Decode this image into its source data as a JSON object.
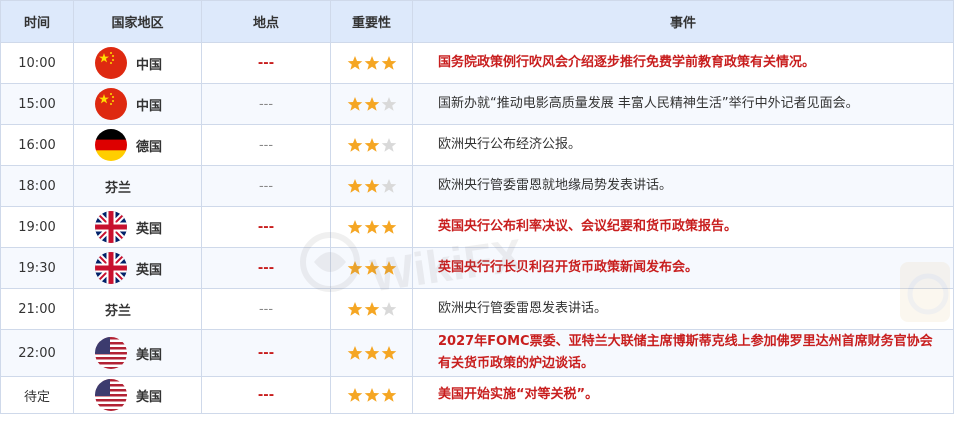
{
  "headers": {
    "time": "时间",
    "country": "国家地区",
    "location": "地点",
    "importance": "重要性",
    "event": "事件"
  },
  "rows": [
    {
      "time": "10:00",
      "flag": "china-flag-icon",
      "country": "中国",
      "location": "---",
      "stars": 3,
      "event": "国务院政策例行吹风会介绍逐步推行免费学前教育政策有关情况。",
      "highlight": true
    },
    {
      "time": "15:00",
      "flag": "china-flag-icon",
      "country": "中国",
      "location": "---",
      "stars": 2,
      "event": "国新办就“推动电影高质量发展 丰富人民精神生活”举行中外记者见面会。",
      "highlight": false
    },
    {
      "time": "16:00",
      "flag": "germany-flag-icon",
      "country": "德国",
      "location": "---",
      "stars": 2,
      "event": "欧洲央行公布经济公报。",
      "highlight": false
    },
    {
      "time": "18:00",
      "flag": "",
      "country": "芬兰",
      "location": "---",
      "stars": 2,
      "event": "欧洲央行管委雷恩就地缘局势发表讲话。",
      "highlight": false
    },
    {
      "time": "19:00",
      "flag": "uk-flag-icon",
      "country": "英国",
      "location": "---",
      "stars": 3,
      "event": "英国央行公布利率决议、会议纪要和货币政策报告。",
      "highlight": true
    },
    {
      "time": "19:30",
      "flag": "uk-flag-icon",
      "country": "英国",
      "location": "---",
      "stars": 3,
      "event": "英国央行行长贝利召开货币政策新闻发布会。",
      "highlight": true
    },
    {
      "time": "21:00",
      "flag": "",
      "country": "芬兰",
      "location": "---",
      "stars": 2,
      "event": "欧洲央行管委雷恩发表讲话。",
      "highlight": false
    },
    {
      "time": "22:00",
      "flag": "usa-flag-icon",
      "country": "美国",
      "location": "---",
      "stars": 3,
      "event": "2027年FOMC票委、亚特兰大联储主席博斯蒂克线上参加佛罗里达州首席财务官协会有关货币政策的炉边谈话。",
      "highlight": true
    },
    {
      "time": "待定",
      "flag": "usa-flag-icon",
      "country": "美国",
      "location": "---",
      "stars": 3,
      "event": "美国开始实施“对等关税”。",
      "highlight": true
    }
  ],
  "watermark": "WikiFX",
  "colors": {
    "header_bg": "#dde9fb",
    "highlight_text": "#c81e1e",
    "star_on": "#f5a623",
    "star_off": "#d9d9d9"
  }
}
